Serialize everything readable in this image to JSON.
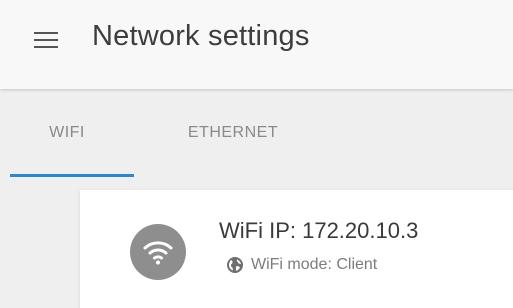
{
  "header": {
    "title": "Network settings",
    "menu_icon": "hamburger-menu-icon"
  },
  "tabs": [
    {
      "label": "WIFI",
      "active": true
    },
    {
      "label": "ETHERNET",
      "active": false
    }
  ],
  "colors": {
    "accent": "#2b86d6",
    "avatar": "#8e8e8e"
  },
  "card": {
    "icon": "wifi-icon",
    "title": "WiFi IP: 172.20.10.3",
    "subtitle_icon": "globe-icon",
    "subtitle": "WiFi mode: Client"
  }
}
